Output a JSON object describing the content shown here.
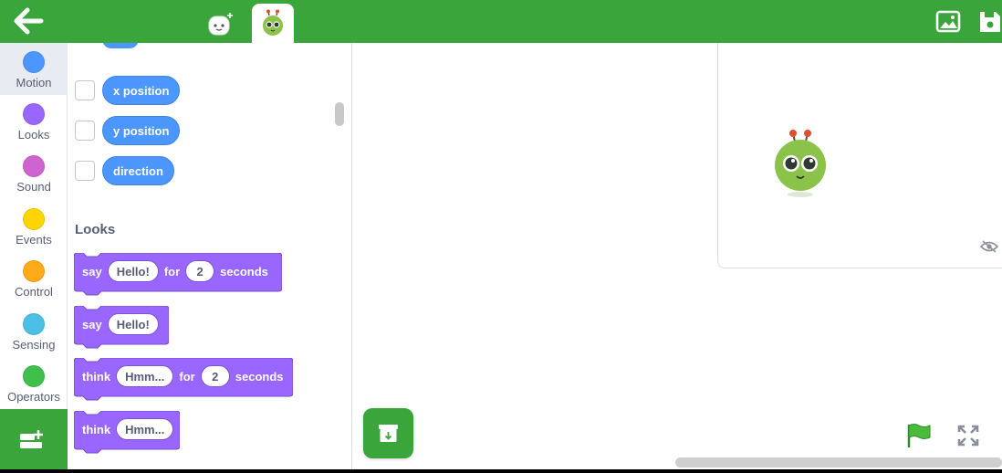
{
  "topbar": {
    "color": "#3aa53a",
    "back_icon": "arrow-left-icon",
    "tabs": [
      {
        "name": "sprite-white",
        "active": false,
        "icon": "white-robot-sprite-icon"
      },
      {
        "name": "sprite-green",
        "active": true,
        "icon": "green-alien-sprite-icon"
      }
    ],
    "right_icons": [
      "image-icon",
      "save-disk-icon"
    ]
  },
  "categories": [
    {
      "label": "Motion",
      "color": "#4c97ff",
      "selected": true
    },
    {
      "label": "Looks",
      "color": "#9966ff",
      "selected": false
    },
    {
      "label": "Sound",
      "color": "#cf63cf",
      "selected": false
    },
    {
      "label": "Events",
      "color": "#ffd500",
      "selected": false
    },
    {
      "label": "Control",
      "color": "#ffab19",
      "selected": false
    },
    {
      "label": "Sensing",
      "color": "#4cbfe6",
      "selected": false
    },
    {
      "label": "Operators",
      "color": "#40bf4a",
      "selected": false
    }
  ],
  "extension_icon": "add-extension-icon",
  "palette": {
    "motion_reporters": [
      {
        "label": "x position"
      },
      {
        "label": "y position"
      },
      {
        "label": "direction"
      }
    ],
    "looks_title": "Looks",
    "looks_blocks": {
      "say_for": {
        "word1": "say",
        "arg1": "Hello!",
        "word2": "for",
        "arg2": "2",
        "word3": "seconds"
      },
      "say": {
        "word1": "say",
        "arg1": "Hello!"
      },
      "think_for": {
        "word1": "think",
        "arg1": "Hmm...",
        "word2": "for",
        "arg2": "2",
        "word3": "seconds"
      },
      "think": {
        "word1": "think",
        "arg1": "Hmm..."
      }
    },
    "looks_color": "#9966ff"
  },
  "stage": {
    "sprite_icon": "green-alien-sprite-icon",
    "hide_icon": "eye-slash-icon"
  },
  "controls": {
    "save_icon": "archive-download-icon",
    "flag_icon": "green-flag-icon",
    "fullscreen_icon": "fullscreen-icon"
  }
}
